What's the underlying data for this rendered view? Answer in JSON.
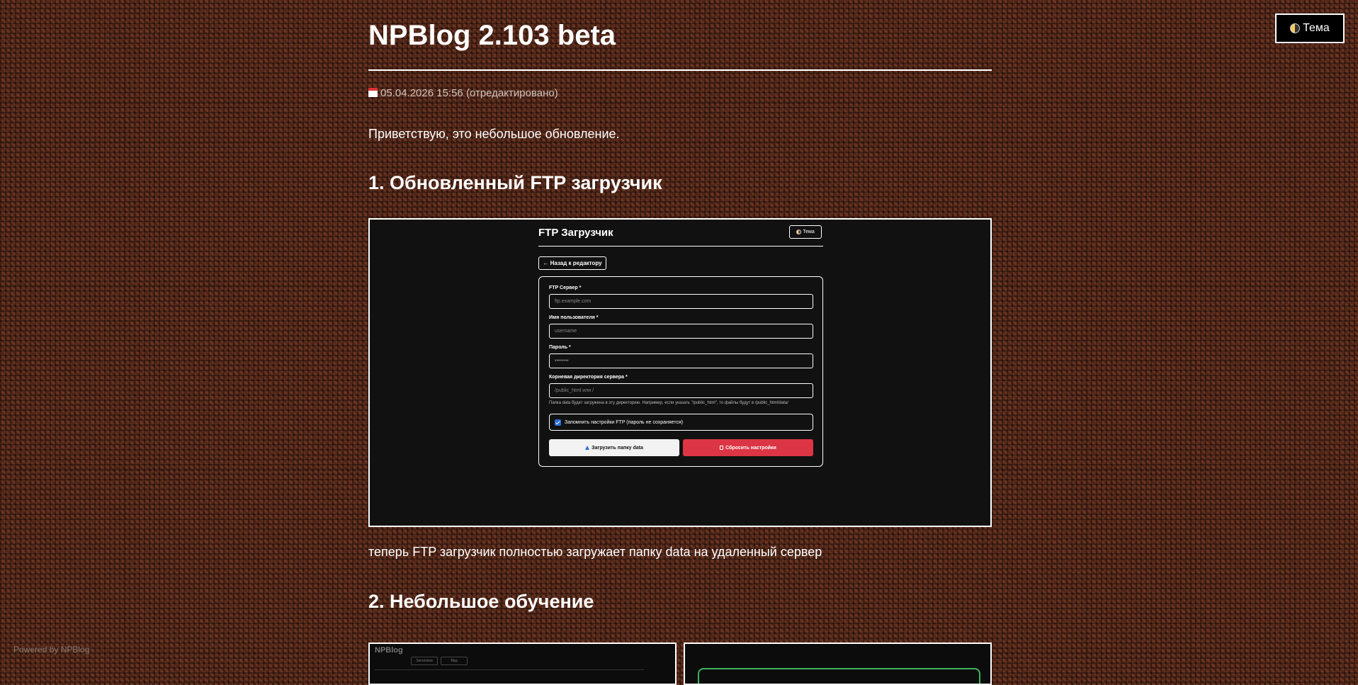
{
  "theme_button": {
    "label": "Тема",
    "icon": "half-moon-icon"
  },
  "post": {
    "title": "NPBlog 2.103 beta",
    "date": "05.04.2026 15:56 (отредактировано)",
    "date_icon": "calendar-icon",
    "intro": "Приветствую, это небольшое обновление.",
    "sections": [
      {
        "heading": "1. Обновленный FTP загрузчик"
      },
      {
        "heading": "2. Небольшое обучение"
      }
    ],
    "after_image_text": "теперь FTP загрузчик полностью загружает папку data на удаленный сервер"
  },
  "ftp_screenshot": {
    "title": "FTP Загрузчик",
    "theme_label": "Тема",
    "back_label": "← Назад к редактору",
    "fields": [
      {
        "label": "FTP Сервер *",
        "placeholder": "ftp.example.com"
      },
      {
        "label": "Имя пользователя *",
        "placeholder": "username"
      },
      {
        "label": "Пароль *",
        "placeholder": "••••••••"
      },
      {
        "label": "Корневая директория сервера *",
        "placeholder": "/public_html или /"
      }
    ],
    "hint": "Папка data будет загружена в эту директорию. Например, если указать \"/public_html\", то файлы будут в /public_html/data/",
    "remember_label": "Запомнить настройки FTP (пароль не сохраняется)",
    "remember_checked": true,
    "upload_label": "Загрузить папку data",
    "reset_label": "Сбросить настройки",
    "reset_color": "#dc3545"
  },
  "thumbnail_left": {
    "title": "NPBlog",
    "tabs": [
      "Заголовок",
      "Вид"
    ]
  },
  "footer": {
    "powered": "Powered by NPBlog"
  }
}
